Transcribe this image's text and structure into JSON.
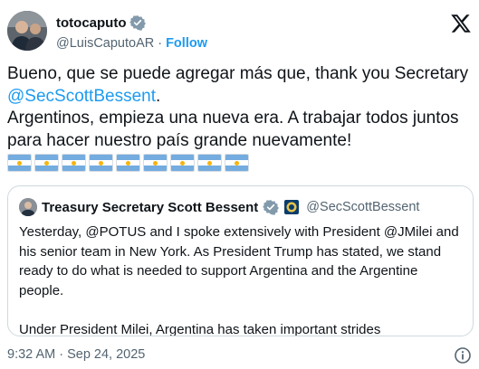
{
  "author": {
    "display_name": "totocaputo",
    "handle": "@LuisCaputoAR",
    "separator": "·",
    "follow_label": "Follow",
    "verified_color": "#829aab",
    "avatar_icon": "person-photo"
  },
  "tweet": {
    "text_before_mention": "Bueno, que se puede agregar más que, thank you Secretary ",
    "mention": "@SecScottBessent",
    "text_after_mention": ".",
    "line2": "Argentinos, empieza una nueva era. A trabajar todos juntos para hacer nuestro país grande nuevamente!",
    "flag_count": 9,
    "flag_icon": "argentina-flag"
  },
  "quote": {
    "display_name": "Treasury Secretary Scott Bessent",
    "handle": "@SecScottBessent",
    "verified_color": "#829aab",
    "affiliation_icon": "us-treasury-seal",
    "text": "Yesterday, @POTUS and I spoke extensively with President @JMilei and his senior team in New York.  As President Trump has stated, we stand ready to do what is needed to support Argentina and the Argentine people.\n\nUnder President Milei, Argentina has taken important strides"
  },
  "footer": {
    "timestamp": "9:32 AM · Sep 24, 2025",
    "info_icon": "info-icon"
  },
  "colors": {
    "accent": "#1d9bf0",
    "secondary_text": "#536471",
    "primary_text": "#0f1419",
    "border": "#cfd9de",
    "flag_blue": "#74acdf",
    "flag_sun": "#f6b40e"
  }
}
